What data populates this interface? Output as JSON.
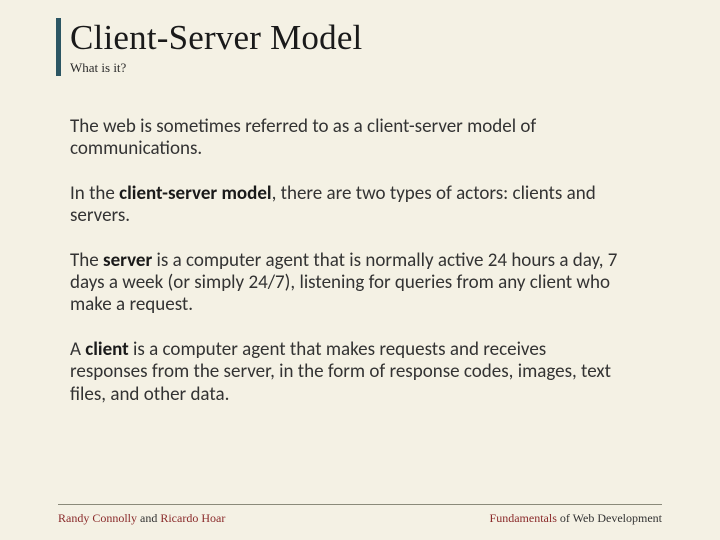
{
  "title": "Client-Server Model",
  "subtitle": "What is it?",
  "paragraphs": {
    "p1": "The web is sometimes referred to as a client-server model of communications.",
    "p2_pre": "In the ",
    "p2_bold": "client-server model",
    "p2_post": ", there are two types of actors: clients and servers.",
    "p3_pre": "The ",
    "p3_bold": "server",
    "p3_post": " is a computer agent that is normally active 24 hours a day, 7 days a week (or simply 24/7), listening for queries from any client who make a request.",
    "p4_pre": "A ",
    "p4_bold": "client",
    "p4_post": " is a computer agent that makes requests and receives responses from the server, in the form of response codes, images, text files, and other data."
  },
  "footer": {
    "author1": "Randy Connolly",
    "conj": " and ",
    "author2": "Ricardo Hoar",
    "right_accent": "Fundamentals",
    "right_rest": " of Web Development"
  }
}
